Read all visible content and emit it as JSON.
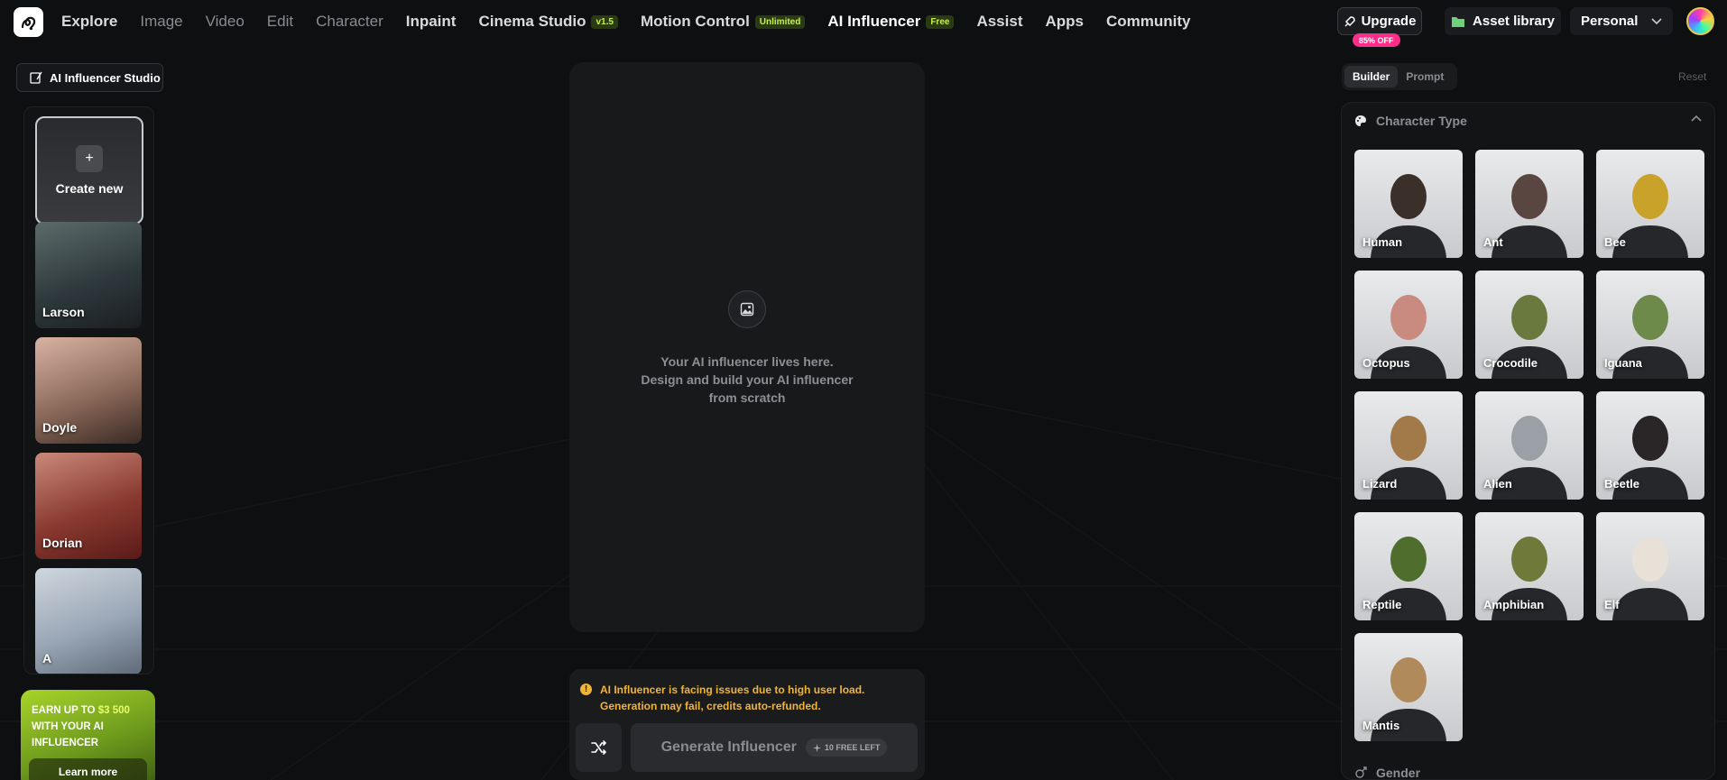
{
  "nav": {
    "items": [
      {
        "label": "Explore",
        "style": "normal"
      },
      {
        "label": "Image",
        "style": "dim"
      },
      {
        "label": "Video",
        "style": "dim"
      },
      {
        "label": "Edit",
        "style": "dim"
      },
      {
        "label": "Character",
        "style": "dim"
      },
      {
        "label": "Inpaint",
        "style": "normal"
      },
      {
        "label": "Cinema Studio",
        "style": "normal",
        "badge": "v1.5",
        "badge_style": "dark"
      },
      {
        "label": "Motion Control",
        "style": "normal",
        "badge": "Unlimited",
        "badge_style": "dark"
      },
      {
        "label": "AI Influencer",
        "style": "active",
        "badge": "Free",
        "badge_style": "dark"
      },
      {
        "label": "Assist",
        "style": "normal"
      },
      {
        "label": "Apps",
        "style": "normal"
      },
      {
        "label": "Community",
        "style": "normal"
      }
    ],
    "upgrade_label": "Upgrade",
    "upgrade_badge": "85% OFF",
    "asset_library_label": "Asset library",
    "workspace_label": "Personal"
  },
  "left": {
    "studio_label": "AI Influencer Studio",
    "create_label": "Create new",
    "characters": [
      {
        "name": "Larson",
        "palette": [
          "#5c6b6a",
          "#2f3a3d",
          "#1a1e21"
        ]
      },
      {
        "name": "Doyle",
        "palette": [
          "#d9b3a3",
          "#8c6a5a",
          "#3a2a24"
        ]
      },
      {
        "name": "Dorian",
        "palette": [
          "#c98a7a",
          "#8a3a30",
          "#5a1a18"
        ]
      },
      {
        "name": "A",
        "palette": [
          "#cfd6de",
          "#9aa7b6",
          "#5e6a78"
        ]
      }
    ],
    "earn": {
      "pre": "EARN UP TO",
      "amount": "$3 500",
      "post": "WITH YOUR AI INFLUENCER",
      "button": "Learn more"
    }
  },
  "center": {
    "placeholder_line1": "Your AI influencer lives here.",
    "placeholder_line2": "Design and build your AI influencer",
    "placeholder_line3": "from scratch",
    "warning": "AI Influencer is facing issues due to high user load. Generation may fail, credits auto-refunded.",
    "generate_label": "Generate Influencer",
    "free_left": "10 FREE LEFT"
  },
  "right": {
    "tabs": [
      "Builder",
      "Prompt"
    ],
    "active_tab": "Builder",
    "reset_label": "Reset",
    "section_title": "Character Type",
    "types": [
      {
        "name": "Human",
        "color": "#3b2f2a"
      },
      {
        "name": "Ant",
        "color": "#5a4640"
      },
      {
        "name": "Bee",
        "color": "#c9a22a"
      },
      {
        "name": "Octopus",
        "color": "#c98a7f"
      },
      {
        "name": "Crocodile",
        "color": "#6a7a3e"
      },
      {
        "name": "Iguana",
        "color": "#6d8a4a"
      },
      {
        "name": "Lizard",
        "color": "#a27a4a"
      },
      {
        "name": "Alien",
        "color": "#9aa0a6"
      },
      {
        "name": "Beetle",
        "color": "#2a2526"
      },
      {
        "name": "Reptile",
        "color": "#4f6e2e"
      },
      {
        "name": "Amphibian",
        "color": "#6f7a3a"
      },
      {
        "name": "Elf",
        "color": "#e8e1d8"
      },
      {
        "name": "Mantis",
        "color": "#b08a5a"
      }
    ],
    "next_section": "Gender"
  },
  "colors": {
    "accent": "#c8f04c",
    "warning": "#f0b437",
    "pink": "#ff2d8a"
  }
}
